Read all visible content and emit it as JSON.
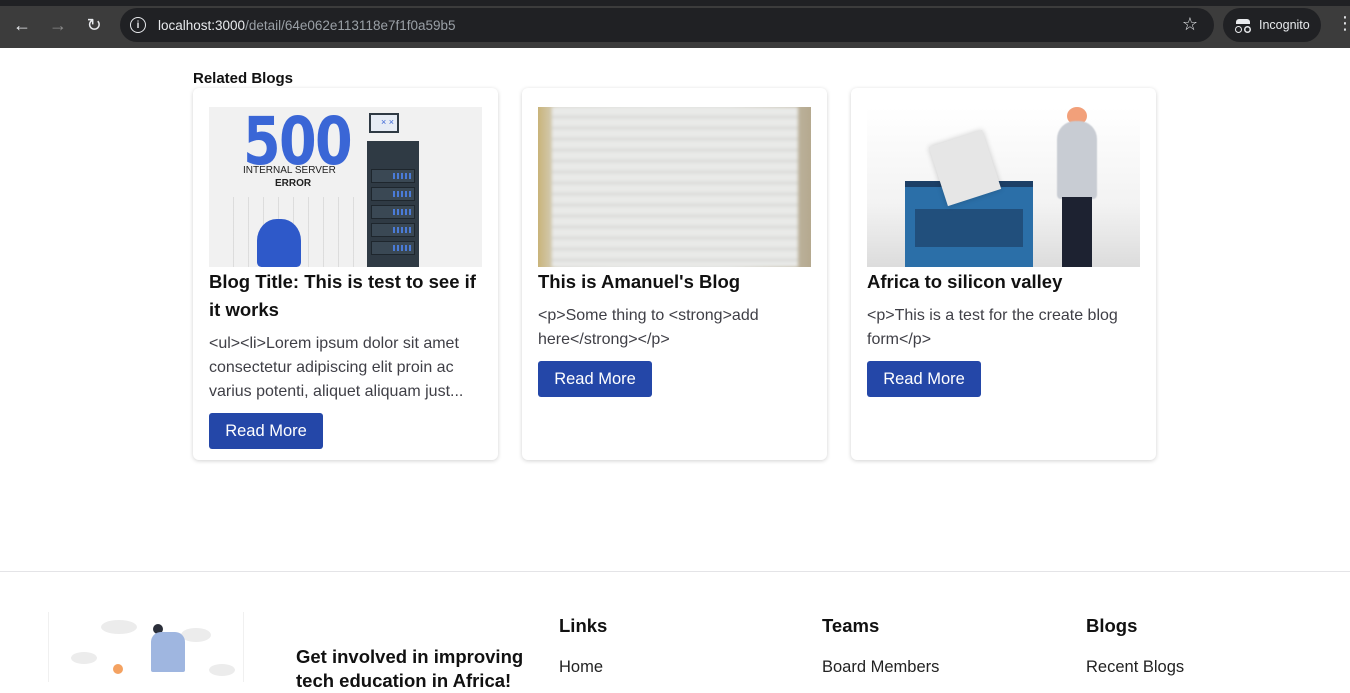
{
  "browser": {
    "url_host": "localhost:3000",
    "url_path": "/detail/64e062e113118e7f1f0a59b5",
    "incognito_label": "Incognito",
    "icons": [
      "back-arrow-icon",
      "forward-arrow-icon",
      "reload-icon",
      "site-info-icon",
      "bookmark-star-icon",
      "incognito-icon",
      "more-menu-icon"
    ]
  },
  "related": {
    "heading": "Related Blogs",
    "cards": [
      {
        "image_text_big": "500",
        "image_text_sub1": "INTERNAL SERVER",
        "image_text_sub2": "ERROR",
        "title": "Blog Title: This is test to see if it works",
        "excerpt": "<ul><li>Lorem ipsum dolor sit amet consectetur adipiscing elit proin ac varius potenti, aliquet aliquam just...",
        "button": "Read More"
      },
      {
        "title": "This is Amanuel's Blog",
        "excerpt": "<p>Some thing to <strong>add here</strong></p>",
        "button": "Read More"
      },
      {
        "title": "Africa to silicon valley",
        "excerpt": "<p>This is a test for the create blog form</p>",
        "button": "Read More"
      }
    ]
  },
  "footer": {
    "cta": "Get involved in improving",
    "cta_second": "tech education in Africa!",
    "columns": [
      {
        "title": "Links",
        "first_link": "Home"
      },
      {
        "title": "Teams",
        "first_link": "Board Members"
      },
      {
        "title": "Blogs",
        "first_link": "Recent Blogs"
      }
    ]
  },
  "colors": {
    "button_bg": "#2447a8",
    "chrome_bg": "#3c3c3c",
    "accent_blue": "#3a66d6"
  }
}
